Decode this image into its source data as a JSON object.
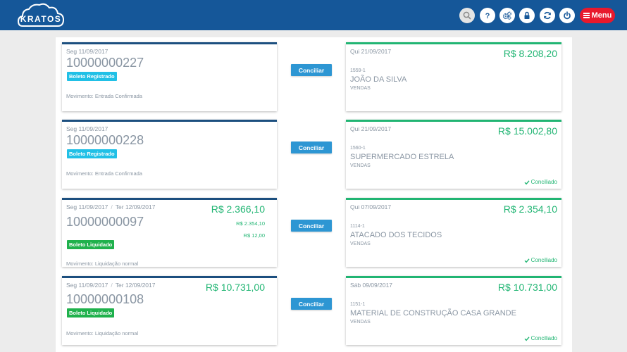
{
  "app": {
    "logo_text": "KRATOS"
  },
  "toolbar": {
    "menu_label": "Menu"
  },
  "colors": {
    "header": "#155799",
    "accent_green": "#21b573",
    "button_blue": "#2d96d3",
    "menu_red": "#e8192c",
    "badge_registered": "#21c0e6",
    "badge_settled": "#1fb14c"
  },
  "action_label": "Conciliar",
  "rows": [
    {
      "bank": {
        "date": "Seg 11/09/2017",
        "date2": "",
        "number": "10000000227",
        "amount": "",
        "sub_amount1": "",
        "sub_amount2": "",
        "badge": "Boleto Registrado",
        "badge_type": "reg",
        "movement": "Movimento: Entrada Confirmada"
      },
      "entry": {
        "date": "Qui 21/09/2017",
        "amount": "R$ 8.208,20",
        "code": "1559-1",
        "name": "JOÃO DA SILVA",
        "category": "VENDAS",
        "status": ""
      }
    },
    {
      "bank": {
        "date": "Seg 11/09/2017",
        "date2": "",
        "number": "10000000228",
        "amount": "",
        "sub_amount1": "",
        "sub_amount2": "",
        "badge": "Boleto Registrado",
        "badge_type": "reg",
        "movement": "Movimento: Entrada Confirmada"
      },
      "entry": {
        "date": "Qui 21/09/2017",
        "amount": "R$ 15.002,80",
        "code": "1560-1",
        "name": "SUPERMERCADO ESTRELA",
        "category": "VENDAS",
        "status": "Conciliado"
      }
    },
    {
      "bank": {
        "date": "Seg 11/09/2017",
        "date2": "Ter 12/09/2017",
        "number": "10000000097",
        "amount": "R$ 2.366,10",
        "sub_amount1": "R$ 2.354,10",
        "sub_amount2": "R$ 12,00",
        "badge": "Boleto Liquidado",
        "badge_type": "liq",
        "movement": "Movimento: Liquidação normal"
      },
      "entry": {
        "date": "Qui 07/09/2017",
        "amount": "R$ 2.354,10",
        "code": "1114-1",
        "name": "ATACADO DOS TECIDOS",
        "category": "VENDAS",
        "status": "Conciliado"
      }
    },
    {
      "bank": {
        "date": "Seg 11/09/2017",
        "date2": "Ter 12/09/2017",
        "number": "10000000108",
        "amount": "R$ 10.731,00",
        "sub_amount1": "",
        "sub_amount2": "",
        "badge": "Boleto Liquidado",
        "badge_type": "liq",
        "movement": "Movimento: Liquidação normal"
      },
      "entry": {
        "date": "Sáb 09/09/2017",
        "amount": "R$ 10.731,00",
        "code": "1151-1",
        "name": "MATERIAL DE CONSTRUÇÃO CASA GRANDE",
        "category": "VENDAS",
        "status": "Conciliado"
      }
    }
  ]
}
